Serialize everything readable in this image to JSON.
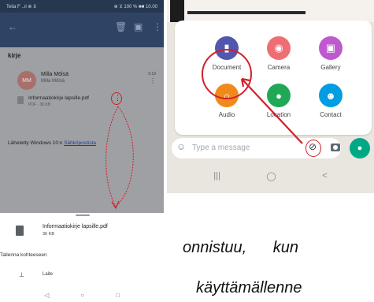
{
  "left_phone": {
    "status_bar": {
      "left": "Telia F ..ıl ⊕ ⊻",
      "right": "⊕ ⊻ 100 % ■■ 10.00"
    },
    "appbar": {
      "back_icon": "arrow-left-icon",
      "actions": [
        "trash-icon",
        "archive-icon",
        "more-vertical-icon"
      ]
    },
    "mail": {
      "subject": "kirje",
      "sender_initials": "MM",
      "sender_name": "Milla Mölsä",
      "sender_to": "Milla Mölsä",
      "time": "9.19",
      "attachment_name": "Informaatiokirje lapsille.pdf",
      "attachment_meta": "PDF · 36 KB",
      "signature_prefix": "Lähetetty Windows 10:n ",
      "signature_link": "Sähköpostista"
    },
    "sheet": {
      "file_name": "Informaatiokirje lapsille.pdf",
      "file_size": "36 KB",
      "save_to": "Tallenna kohteeseen",
      "download_label": "Laite"
    },
    "nav": [
      "◁",
      "○",
      "□"
    ]
  },
  "right_phone": {
    "attach_options": [
      {
        "label": "Document",
        "color": "#5157ae",
        "icon": "document-icon"
      },
      {
        "label": "Camera",
        "color": "#ee6e73",
        "icon": "camera-icon"
      },
      {
        "label": "Gallery",
        "color": "#bf59cf",
        "icon": "gallery-icon"
      },
      {
        "label": "Audio",
        "color": "#f28a1b",
        "icon": "headphones-icon"
      },
      {
        "label": "Location",
        "color": "#1fa855",
        "icon": "location-pin-icon"
      },
      {
        "label": "Contact",
        "color": "#009de2",
        "icon": "contact-icon"
      }
    ],
    "input_placeholder": "Type a message",
    "nav": [
      "|||",
      "◯",
      "<"
    ]
  },
  "caption": {
    "line1": "onnistuu, kun",
    "line2": "käyttämällenne"
  },
  "colors": {
    "annotation_red": "#d21f2a",
    "whatsapp_green": "#00a884"
  }
}
